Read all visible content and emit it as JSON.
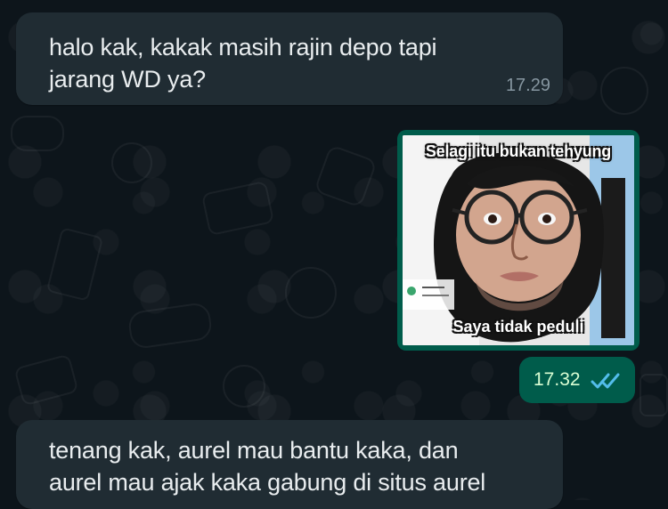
{
  "messages": [
    {
      "direction": "incoming",
      "text_line_1": "halo kak, kakak masih rajin depo tapi",
      "text_line_2": "jarang WD ya?",
      "time": "17.29"
    },
    {
      "direction": "outgoing",
      "meme_top_text": "Selagi itu bukan tehyung",
      "meme_bottom_text": "Saya tidak peduli",
      "time": "17.32",
      "status": "read"
    },
    {
      "direction": "incoming",
      "text_line_1": "tenang kak, aurel mau bantu kaka, dan",
      "text_line_2": "aurel mau ajak kaka gabung di situs aurel"
    }
  ],
  "colors": {
    "background": "#0b141a",
    "incoming_bubble": "#202c33",
    "outgoing_bubble": "#005c4b",
    "read_ticks": "#53bdeb",
    "time_text": "#8696a0"
  },
  "icons": {
    "read_receipt": "double-check-icon"
  }
}
